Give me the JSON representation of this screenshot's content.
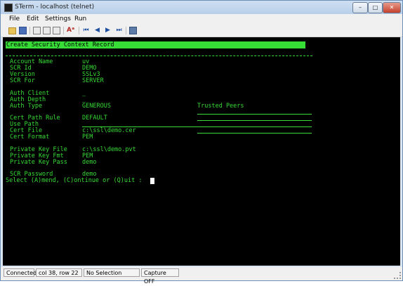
{
  "window": {
    "title": "STerm - localhost (telnet)",
    "controls": {
      "minimize": "–",
      "maximize": "□",
      "close": "✕"
    }
  },
  "menu": [
    "File",
    "Edit",
    "Settings",
    "Run"
  ],
  "toolbar_icons": [
    "open-folder-icon",
    "save-icon",
    "copy-icon",
    "paste-icon",
    "print-icon",
    "font-icon",
    "first-icon",
    "prev-icon",
    "next-icon",
    "last-icon",
    "capture-icon"
  ],
  "terminal": {
    "header": "Create Security Context Record",
    "fields": [
      {
        "label": "Account Name",
        "value": "uv"
      },
      {
        "label": "SCR Id",
        "value": "DEMO"
      },
      {
        "label": "Version",
        "value": "SSLv3"
      },
      {
        "label": "SCR For",
        "value": "SERVER"
      },
      {
        "label": "Auth Client",
        "value": "_"
      },
      {
        "label": "Auth Depth",
        "value": "_"
      },
      {
        "label": "Auth Type",
        "value": "GENEROUS"
      },
      {
        "label": "Cert Path Rule",
        "value": "DEFAULT"
      },
      {
        "label": "Use Path",
        "value": ""
      },
      {
        "label": "Cert File",
        "value": "c:\\ssl\\demo.cer"
      },
      {
        "label": "Cert Format",
        "value": "PEM"
      },
      {
        "label": "Private Key File",
        "value": "c:\\ssl\\demo.pvt"
      },
      {
        "label": "Private Key Fmt",
        "value": "PEM"
      },
      {
        "label": "Private Key Pass",
        "value": "demo"
      },
      {
        "label": "SCR Password",
        "value": "demo"
      }
    ],
    "trusted_peers_label": "Trusted Peers",
    "prompt": "Select (A)mend, (C)ontinue or (Q)uit :"
  },
  "status": {
    "connection": "Connected",
    "position": "col 38, row 22",
    "selection": "No Selection",
    "capture": "Capture OFF"
  },
  "colors": {
    "terminal_bg": "#000000",
    "terminal_fg": "#37dc37",
    "cursor": "#ffffff"
  }
}
